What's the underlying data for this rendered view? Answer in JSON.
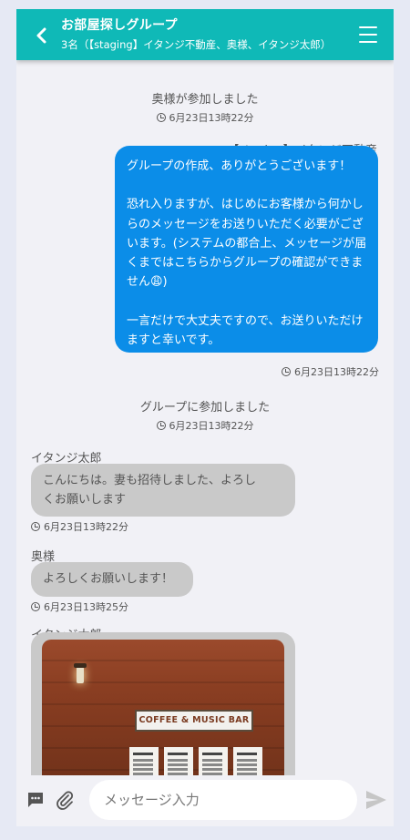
{
  "header": {
    "title": "お部屋探しグループ",
    "subtitle": "3名（【staging】イタンジ不動産、奥様、イタンジ太郎）"
  },
  "messages": {
    "sys1": {
      "text": "奥様が参加しました",
      "time": "6月23日13時22分"
    },
    "out1": {
      "sender": "【staging】イタンジ不動産",
      "text": "グループの作成、ありがとうございます！\n\n恐れ入りますが、はじめにお客様から何かしらのメッセージをお送りいただく必要がございます。(システムの都合上、メッセージが届くまではこちらからグループの確認ができません😩)\n\n一言だけで大丈夫ですので、お送りいただけますと幸いです。",
      "time": "6月23日13時22分"
    },
    "sys2": {
      "text": "グループに参加しました",
      "time": "6月23日13時22分"
    },
    "in1": {
      "sender": "イタンジ太郎",
      "text": "こんにちは。妻も招待しました、よろし\nくお願いします",
      "time": "6月23日13時22分"
    },
    "in2": {
      "sender": "奥様",
      "text": "よろしくお願いします！",
      "time": "6月23日13時25分"
    },
    "in3": {
      "sender": "イタンジ太郎",
      "image_sign": "COFFEE & MUSIC BAR",
      "menu_boards": [
        "SPECIAL",
        "PINT",
        "CLASSIC",
        "OTHERS"
      ]
    }
  },
  "input": {
    "placeholder": "メッセージ入力",
    "value": ""
  },
  "icons": {
    "back": "chevron-left-icon",
    "menu": "hamburger-menu-icon",
    "clock": "clock-icon",
    "template": "chat-bubble-icon",
    "attach": "paperclip-icon",
    "send": "send-icon"
  },
  "colors": {
    "header": "#0fb9b7",
    "outgoing_bubble": "#0b8de8",
    "incoming_bubble": "#c9c9c9"
  }
}
